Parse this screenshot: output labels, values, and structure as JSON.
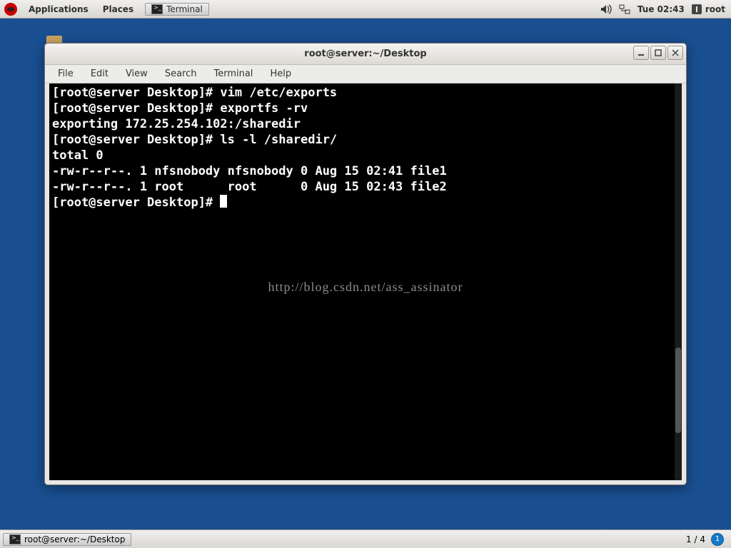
{
  "top_panel": {
    "applications": "Applications",
    "places": "Places",
    "task_button": "Terminal",
    "clock": "Tue 02:43",
    "user": "root"
  },
  "window": {
    "title": "root@server:~/Desktop",
    "menus": {
      "file": "File",
      "edit": "Edit",
      "view": "View",
      "search": "Search",
      "terminal": "Terminal",
      "help": "Help"
    }
  },
  "terminal": {
    "lines": [
      "[root@server Desktop]# vim /etc/exports",
      "[root@server Desktop]# exportfs -rv",
      "exporting 172.25.254.102:/sharedir",
      "[root@server Desktop]# ls -l /sharedir/",
      "total 0",
      "-rw-r--r--. 1 nfsnobody nfsnobody 0 Aug 15 02:41 file1",
      "-rw-r--r--. 1 root      root      0 Aug 15 02:43 file2",
      "[root@server Desktop]# "
    ],
    "watermark": "http://blog.csdn.net/ass_assinator"
  },
  "bottom_panel": {
    "task": "root@server:~/Desktop",
    "pager": "1 / 4",
    "workspace_current": "1"
  }
}
